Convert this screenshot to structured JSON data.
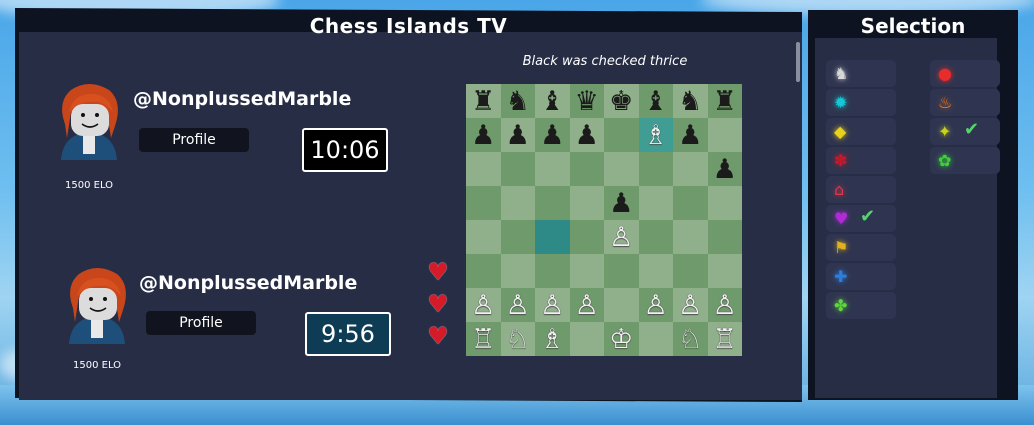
{
  "window": {
    "title": "Chess Islands TV"
  },
  "selection": {
    "title": "Selection",
    "left_items": [
      {
        "icon": "knight-icon",
        "glyph": "♞",
        "color": "#d8d8d8",
        "selected": false
      },
      {
        "icon": "cyan-gem-icon",
        "glyph": "✹",
        "color": "#18c7d6",
        "selected": false
      },
      {
        "icon": "duck-icon",
        "glyph": "◆",
        "color": "#e9d21c",
        "selected": false
      },
      {
        "icon": "red-flower-icon",
        "glyph": "✽",
        "color": "#c8182a",
        "selected": false
      },
      {
        "icon": "house-icon",
        "glyph": "⌂",
        "color": "#e2344a",
        "selected": false
      },
      {
        "icon": "purple-heart-icon",
        "glyph": "♥",
        "color": "#b12ad6",
        "selected": true
      },
      {
        "icon": "flag-icon",
        "glyph": "⚑",
        "color": "#e0b11e",
        "selected": false
      },
      {
        "icon": "blue-puzzle-icon",
        "glyph": "✚",
        "color": "#2a7ee0",
        "selected": false
      },
      {
        "icon": "gift-icon",
        "glyph": "✤",
        "color": "#5fd63d",
        "selected": false
      }
    ],
    "right_items": [
      {
        "icon": "red-shape-icon",
        "glyph": "●",
        "color": "#e82b2b",
        "selected": false
      },
      {
        "icon": "fire-icon",
        "glyph": "♨",
        "color": "#ff7a1a",
        "selected": false
      },
      {
        "icon": "yellow-bird-icon",
        "glyph": "✦",
        "color": "#c8d21c",
        "selected": true
      },
      {
        "icon": "green-leaf-icon",
        "glyph": "✿",
        "color": "#3fd13a",
        "selected": false
      }
    ]
  },
  "board": {
    "caption": "Black was checked thrice",
    "rows": [
      [
        "♜",
        "♞",
        "♝",
        "♛",
        "♚",
        "♝",
        "♞",
        "♜"
      ],
      [
        "♟",
        "♟",
        "♟",
        "♟",
        "",
        "♗",
        "♟",
        ""
      ],
      [
        "",
        "",
        "",
        "",
        "",
        "",
        "",
        "♟"
      ],
      [
        "",
        "",
        "",
        "",
        "♟",
        "",
        "",
        ""
      ],
      [
        "",
        "",
        "",
        "",
        "♙",
        "",
        "",
        ""
      ],
      [
        "",
        "",
        "",
        "",
        "",
        "",
        "",
        ""
      ],
      [
        "♙",
        "♙",
        "♙",
        "♙",
        "",
        "♙",
        "♙",
        "♙"
      ],
      [
        "♖",
        "♘",
        "♗",
        "",
        "♔",
        "",
        "♘",
        "♖"
      ]
    ],
    "highlight": [
      [
        1,
        5
      ],
      [
        4,
        2
      ]
    ],
    "hearts": 3
  },
  "player_top": {
    "handle": "@NonplussedMarble",
    "profile_label": "Profile",
    "clock": "10:06",
    "elo": "1500 ELO",
    "clock_bg": "#000000"
  },
  "player_bottom": {
    "handle": "@NonplussedMarble",
    "profile_label": "Profile",
    "clock": "9:56",
    "elo": "1500 ELO",
    "clock_bg": "#0e3c55"
  }
}
